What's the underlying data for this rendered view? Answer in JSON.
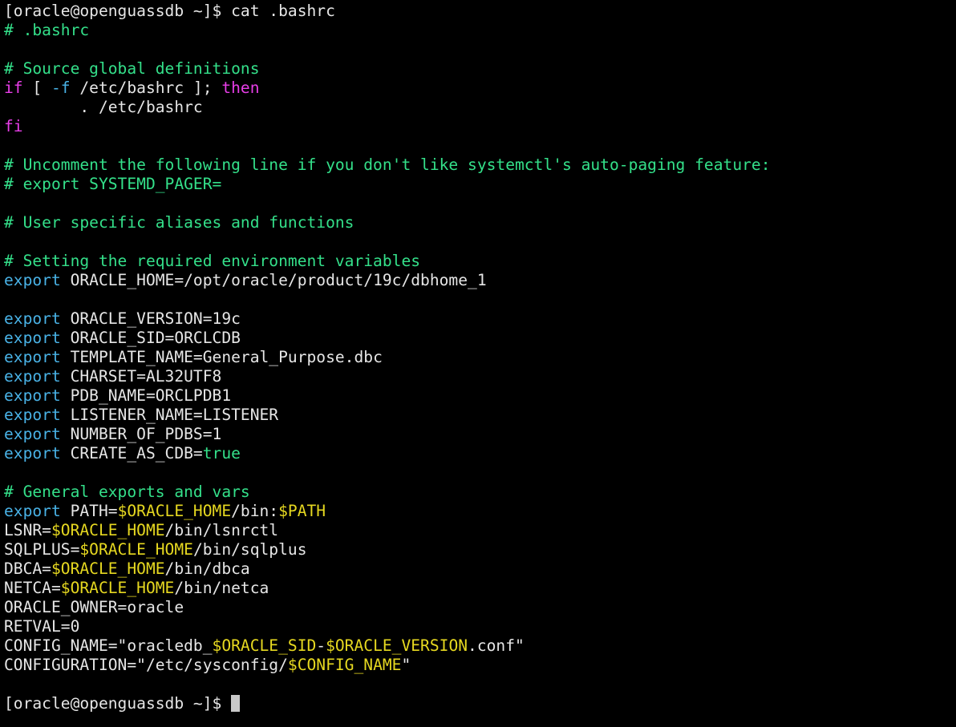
{
  "window": {
    "type": "terminal",
    "background": "#000000",
    "colors": {
      "text": "#e6e6e6",
      "comment": "#34e08a",
      "keyword": "#e83ee8",
      "export_keyword": "#49b2e6",
      "variable": "#e6d820",
      "cursor": "#c8c8c8"
    }
  },
  "lines": [
    [
      {
        "t": "text",
        "v": "[oracle@openguassdb ~]$ cat .bashrc"
      }
    ],
    [
      {
        "t": "comment",
        "v": "# .bashrc"
      }
    ],
    [],
    [
      {
        "t": "comment",
        "v": "# Source global definitions"
      }
    ],
    [
      {
        "t": "keyword",
        "v": "if"
      },
      {
        "t": "text",
        "v": " [ "
      },
      {
        "t": "flag",
        "v": "-f"
      },
      {
        "t": "text",
        "v": " /etc/bashrc ]; "
      },
      {
        "t": "keyword",
        "v": "then"
      }
    ],
    [
      {
        "t": "text",
        "v": "        . /etc/bashrc"
      }
    ],
    [
      {
        "t": "keyword",
        "v": "fi"
      }
    ],
    [],
    [
      {
        "t": "comment",
        "v": "# Uncomment the following line if you don't like systemctl's auto-paging feature:"
      }
    ],
    [
      {
        "t": "comment",
        "v": "# export SYSTEMD_PAGER="
      }
    ],
    [],
    [
      {
        "t": "comment",
        "v": "# User specific aliases and functions"
      }
    ],
    [],
    [
      {
        "t": "comment",
        "v": "# Setting the required environment variables"
      }
    ],
    [
      {
        "t": "export",
        "v": "export"
      },
      {
        "t": "text",
        "v": " ORACLE_HOME=/opt/oracle/product/19c/dbhome_1"
      }
    ],
    [],
    [
      {
        "t": "export",
        "v": "export"
      },
      {
        "t": "text",
        "v": " ORACLE_VERSION=19c"
      }
    ],
    [
      {
        "t": "export",
        "v": "export"
      },
      {
        "t": "text",
        "v": " ORACLE_SID=ORCLCDB"
      }
    ],
    [
      {
        "t": "export",
        "v": "export"
      },
      {
        "t": "text",
        "v": " TEMPLATE_NAME=General_Purpose.dbc"
      }
    ],
    [
      {
        "t": "export",
        "v": "export"
      },
      {
        "t": "text",
        "v": " CHARSET=AL32UTF8"
      }
    ],
    [
      {
        "t": "export",
        "v": "export"
      },
      {
        "t": "text",
        "v": " PDB_NAME=ORCLPDB1"
      }
    ],
    [
      {
        "t": "export",
        "v": "export"
      },
      {
        "t": "text",
        "v": " LISTENER_NAME=LISTENER"
      }
    ],
    [
      {
        "t": "export",
        "v": "export"
      },
      {
        "t": "text",
        "v": " NUMBER_OF_PDBS=1"
      }
    ],
    [
      {
        "t": "export",
        "v": "export"
      },
      {
        "t": "text",
        "v": " CREATE_AS_CDB="
      },
      {
        "t": "bool",
        "v": "true"
      }
    ],
    [],
    [
      {
        "t": "comment",
        "v": "# General exports and vars"
      }
    ],
    [
      {
        "t": "export",
        "v": "export"
      },
      {
        "t": "text",
        "v": " PATH="
      },
      {
        "t": "var",
        "v": "$ORACLE_HOME"
      },
      {
        "t": "text",
        "v": "/bin:"
      },
      {
        "t": "var",
        "v": "$PATH"
      }
    ],
    [
      {
        "t": "text",
        "v": "LSNR="
      },
      {
        "t": "var",
        "v": "$ORACLE_HOME"
      },
      {
        "t": "text",
        "v": "/bin/lsnrctl"
      }
    ],
    [
      {
        "t": "text",
        "v": "SQLPLUS="
      },
      {
        "t": "var",
        "v": "$ORACLE_HOME"
      },
      {
        "t": "text",
        "v": "/bin/sqlplus"
      }
    ],
    [
      {
        "t": "text",
        "v": "DBCA="
      },
      {
        "t": "var",
        "v": "$ORACLE_HOME"
      },
      {
        "t": "text",
        "v": "/bin/dbca"
      }
    ],
    [
      {
        "t": "text",
        "v": "NETCA="
      },
      {
        "t": "var",
        "v": "$ORACLE_HOME"
      },
      {
        "t": "text",
        "v": "/bin/netca"
      }
    ],
    [
      {
        "t": "text",
        "v": "ORACLE_OWNER=oracle"
      }
    ],
    [
      {
        "t": "text",
        "v": "RETVAL=0"
      }
    ],
    [
      {
        "t": "text",
        "v": "CONFIG_NAME=\"oracledb_"
      },
      {
        "t": "var",
        "v": "$ORACLE_SID"
      },
      {
        "t": "text",
        "v": "-"
      },
      {
        "t": "var",
        "v": "$ORACLE_VERSION"
      },
      {
        "t": "text",
        "v": ".conf\""
      }
    ],
    [
      {
        "t": "text",
        "v": "CONFIGURATION=\"/etc/sysconfig/"
      },
      {
        "t": "var",
        "v": "$CONFIG_NAME"
      },
      {
        "t": "text",
        "v": "\""
      }
    ],
    [],
    [
      {
        "t": "text",
        "v": "[oracle@openguassdb ~]$ "
      },
      {
        "t": "cursor",
        "v": ""
      }
    ]
  ]
}
